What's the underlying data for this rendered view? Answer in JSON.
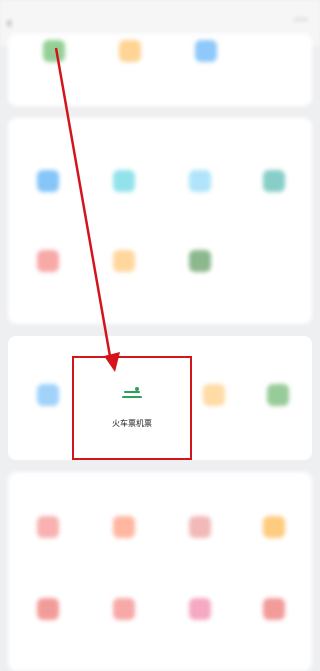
{
  "header": {
    "back_icon": "back-arrow-icon",
    "title": "",
    "more_icon": "more-icon"
  },
  "sections": [
    {
      "title": "",
      "items": [
        {
          "label": "",
          "color": "#4caf50"
        },
        {
          "label": "",
          "color": "#ffb74d"
        },
        {
          "label": "",
          "color": "#42a5f5"
        }
      ]
    },
    {
      "title": "",
      "items": [
        {
          "label": "",
          "color": "#2196f3"
        },
        {
          "label": "",
          "color": "#26c6da"
        },
        {
          "label": "",
          "color": "#4fc3f7"
        },
        {
          "label": "",
          "color": "#26a69a"
        },
        {
          "label": "",
          "color": "#ef5350"
        },
        {
          "label": "",
          "color": "#ffb74d"
        },
        {
          "label": "",
          "color": "#2e7d32"
        }
      ]
    },
    {
      "title": "",
      "items": [
        {
          "label": "",
          "color": "#42a5f5"
        },
        {
          "label": "",
          "color": "#ffb74d"
        },
        {
          "label": "",
          "color": "#43a047"
        }
      ]
    },
    {
      "title": "",
      "items": [
        {
          "label": "",
          "color": "#ef5350"
        },
        {
          "label": "",
          "color": "#ff7043"
        },
        {
          "label": "",
          "color": "#e57373"
        },
        {
          "label": "",
          "color": "#ff9800"
        },
        {
          "label": "",
          "color": "#e53935"
        },
        {
          "label": "",
          "color": "#ef5350"
        },
        {
          "label": "",
          "color": "#ec407a"
        },
        {
          "label": "",
          "color": "#e53935"
        }
      ]
    }
  ],
  "highlight_item": {
    "label": "火车票机票",
    "icon": "train-ticket-icon",
    "color": "#2ea05a"
  },
  "annotation": {
    "color": "#d4141c"
  }
}
